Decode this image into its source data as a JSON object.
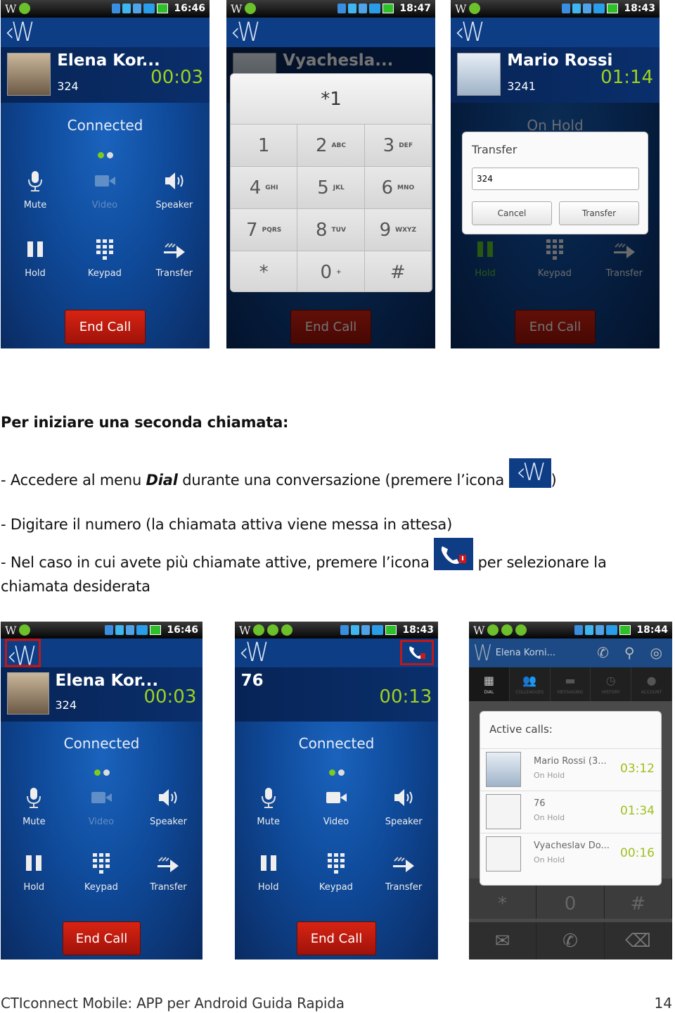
{
  "phones_top": [
    {
      "status_time": "16:46",
      "caller": {
        "name": "Elena Kor...",
        "number": "324",
        "timer": "00:03",
        "avatar": "photo"
      },
      "status": "Connected",
      "buttons": [
        {
          "label": "Mute",
          "icon": "mic-icon",
          "state": "on"
        },
        {
          "label": "Video",
          "icon": "video-icon",
          "state": "off"
        },
        {
          "label": "Speaker",
          "icon": "speaker-icon",
          "state": "on"
        },
        {
          "label": "Hold",
          "icon": "pause-icon",
          "state": "on"
        },
        {
          "label": "Keypad",
          "icon": "keypad-icon",
          "state": "on"
        },
        {
          "label": "Transfer",
          "icon": "transfer-icon",
          "state": "on"
        }
      ],
      "end_call": "End Call"
    },
    {
      "status_time": "18:47",
      "caller": {
        "name": "Vyachesla...",
        "number": "",
        "timer": "",
        "avatar": "person"
      },
      "end_call": "End Call",
      "keypad": {
        "display": "*1",
        "keys": [
          {
            "d": "1",
            "l": ""
          },
          {
            "d": "2",
            "l": "ABC"
          },
          {
            "d": "3",
            "l": "DEF"
          },
          {
            "d": "4",
            "l": "GHI"
          },
          {
            "d": "5",
            "l": "JKL"
          },
          {
            "d": "6",
            "l": "MNO"
          },
          {
            "d": "7",
            "l": "PQRS"
          },
          {
            "d": "8",
            "l": "TUV"
          },
          {
            "d": "9",
            "l": "WXYZ"
          },
          {
            "d": "*",
            "l": ""
          },
          {
            "d": "0",
            "l": "+"
          },
          {
            "d": "#",
            "l": ""
          }
        ]
      }
    },
    {
      "status_time": "18:43",
      "caller": {
        "name": "Mario Rossi",
        "number": "3241",
        "timer": "01:14",
        "avatar": "person"
      },
      "status": "On Hold",
      "buttons": [
        {
          "label": "Hold",
          "icon": "pause-icon",
          "state": "active"
        },
        {
          "label": "Keypad",
          "icon": "keypad-icon",
          "state": "on"
        },
        {
          "label": "Transfer",
          "icon": "transfer-icon",
          "state": "on"
        }
      ],
      "end_call": "End Call",
      "transfer_dialog": {
        "title": "Transfer",
        "input_value": "324",
        "cancel": "Cancel",
        "confirm": "Transfer"
      }
    }
  ],
  "text": {
    "heading": "Per iniziare una seconda chiamata:",
    "line1_a": "- Accedere al menu ",
    "line1_b": "Dial",
    "line1_c": " durante una conversazione (premere l’icona ",
    "line1_d": ")",
    "line2": "- Digitare il numero (la chiamata attiva viene messa in attesa)",
    "line3_a": "- Nel caso in cui avete più chiamate attive, premere l’icona ",
    "line3_b": " per selezionare la",
    "line4": "chiamata desiderata"
  },
  "phones_bottom": [
    {
      "status_time": "16:46",
      "caller": {
        "name": "Elena Kor...",
        "number": "324",
        "timer": "00:03",
        "avatar": "photo"
      },
      "status": "Connected",
      "buttons": [
        {
          "label": "Mute",
          "icon": "mic-icon",
          "state": "on"
        },
        {
          "label": "Video",
          "icon": "video-icon",
          "state": "off"
        },
        {
          "label": "Speaker",
          "icon": "speaker-icon",
          "state": "on"
        },
        {
          "label": "Hold",
          "icon": "pause-icon",
          "state": "on"
        },
        {
          "label": "Keypad",
          "icon": "keypad-icon",
          "state": "on"
        },
        {
          "label": "Transfer",
          "icon": "transfer-icon",
          "state": "on"
        }
      ],
      "end_call": "End Call"
    },
    {
      "status_time": "18:43",
      "caller": {
        "name": "76",
        "number": "",
        "timer": "00:13",
        "avatar": "none"
      },
      "status": "Connected",
      "buttons": [
        {
          "label": "Mute",
          "icon": "mic-icon",
          "state": "on"
        },
        {
          "label": "Video",
          "icon": "video-icon",
          "state": "on"
        },
        {
          "label": "Speaker",
          "icon": "speaker-icon",
          "state": "on"
        },
        {
          "label": "Hold",
          "icon": "pause-icon",
          "state": "on"
        },
        {
          "label": "Keypad",
          "icon": "keypad-icon",
          "state": "on"
        },
        {
          "label": "Transfer",
          "icon": "transfer-icon",
          "state": "on"
        }
      ],
      "end_call": "End Call"
    }
  ],
  "app_phone": {
    "status_time": "18:44",
    "user": "Elena Korni...",
    "tabs": [
      "DIAL",
      "COLLEAGUES",
      "MESSAGING",
      "HISTORY",
      "ACCOUNT"
    ],
    "keys_visible": [
      "*",
      "0",
      "#"
    ],
    "active_calls": {
      "title": "Active calls:",
      "calls": [
        {
          "name": "Mario Rossi (3...",
          "status": "On Hold",
          "timer": "03:12"
        },
        {
          "name": "76",
          "status": "On Hold",
          "timer": "01:34"
        },
        {
          "name": "Vyacheslav Do...",
          "status": "On Hold",
          "timer": "00:16"
        }
      ]
    }
  },
  "footer": {
    "title": "CTIconnect Mobile: APP per Android Guida Rapida",
    "page": "14"
  },
  "colors": {
    "timer": "#9fd21e",
    "end_call": "#c81d0f",
    "header": "#0d3d85"
  }
}
